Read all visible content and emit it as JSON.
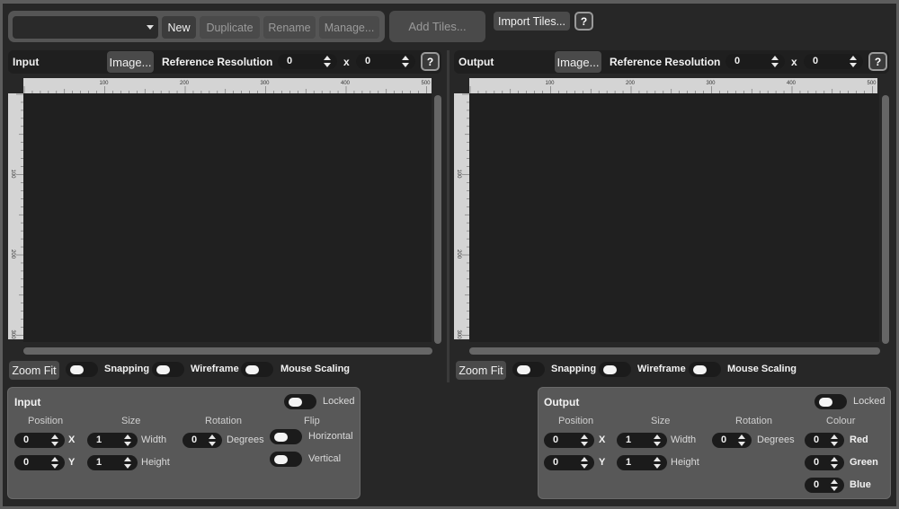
{
  "toolbar": {
    "preset_value": "",
    "new_label": "New",
    "duplicate_label": "Duplicate",
    "rename_label": "Rename",
    "manage_label": "Manage...",
    "add_tiles_label": "Add Tiles...",
    "import_tiles_label": "Import Tiles...",
    "help_label": "?"
  },
  "input_view": {
    "title": "Input",
    "image_label": "Image...",
    "ref_res_label": "Reference Resolution",
    "res_x": "0",
    "x_sep": "x",
    "res_y": "0",
    "help_label": "?",
    "zoom_fit_label": "Zoom Fit",
    "snapping_label": "Snapping",
    "wireframe_label": "Wireframe",
    "mouse_scaling_label": "Mouse Scaling"
  },
  "output_view": {
    "title": "Output",
    "image_label": "Image...",
    "ref_res_label": "Reference Resolution",
    "res_x": "0",
    "x_sep": "x",
    "res_y": "0",
    "help_label": "?",
    "zoom_fit_label": "Zoom Fit",
    "snapping_label": "Snapping",
    "wireframe_label": "Wireframe",
    "mouse_scaling_label": "Mouse Scaling"
  },
  "ruler": {
    "h_labels": [
      "100",
      "200",
      "300",
      "400",
      "500"
    ],
    "v_labels": [
      "100",
      "200",
      "300"
    ]
  },
  "input_panel": {
    "title": "Input",
    "locked_label": "Locked",
    "position_label": "Position",
    "size_label": "Size",
    "rotation_label": "Rotation",
    "flip_label": "Flip",
    "pos_x": "0",
    "pos_x_label": "X",
    "pos_y": "0",
    "pos_y_label": "Y",
    "width": "1",
    "width_label": "Width",
    "height": "1",
    "height_label": "Height",
    "rotation": "0",
    "degrees_label": "Degrees",
    "horizontal_label": "Horizontal",
    "vertical_label": "Vertical"
  },
  "output_panel": {
    "title": "Output",
    "locked_label": "Locked",
    "position_label": "Position",
    "size_label": "Size",
    "rotation_label": "Rotation",
    "colour_label": "Colour",
    "pos_x": "0",
    "pos_x_label": "X",
    "pos_y": "0",
    "pos_y_label": "Y",
    "width": "1",
    "width_label": "Width",
    "height": "1",
    "height_label": "Height",
    "rotation": "0",
    "degrees_label": "Degrees",
    "red": "0",
    "red_label": "Red",
    "green": "0",
    "green_label": "Green",
    "blue": "0",
    "blue_label": "Blue"
  }
}
